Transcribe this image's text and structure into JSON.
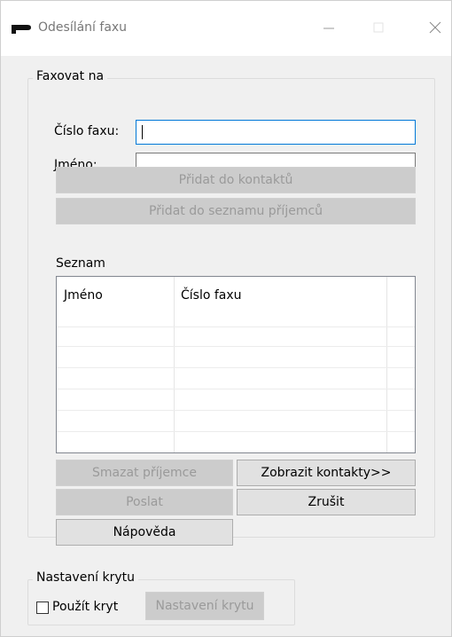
{
  "window": {
    "title": "Odesílání faxu"
  },
  "fax_to": {
    "group_label": "Faxovat na",
    "fax_number_label": "Číslo faxu:",
    "fax_number_value": "",
    "name_label": "Jméno:",
    "name_value": "",
    "add_to_contacts_label": "Přidat do kontaktů",
    "add_to_recipients_label": "Přidat do seznamu příjemců"
  },
  "list": {
    "label": "Seznam",
    "columns": [
      "Jméno",
      "Číslo faxu"
    ],
    "rows": []
  },
  "buttons": {
    "delete_recipient": "Smazat příjemce",
    "show_contacts": "Zobrazit kontakty>>",
    "send": "Poslat",
    "cancel": "Zrušit",
    "help": "Nápověda"
  },
  "cover": {
    "group_label": "Nastavení krytu",
    "use_cover_label": "Použít kryt",
    "use_cover_checked": false,
    "cover_settings_button": "Nastavení krytu"
  },
  "colors": {
    "focus_border": "#0078d7",
    "disabled_button_bg": "#cccccc",
    "disabled_text": "#9a9a9a"
  }
}
